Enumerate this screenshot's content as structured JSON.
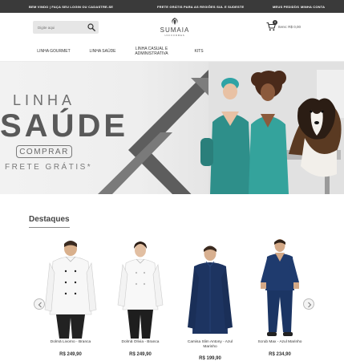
{
  "topbar": {
    "left": "BEM VINDO | FAÇA SEU LOGIN OU CADASTRE-SE",
    "middle": "FRETE GRÁTIS PARA AS REGIÕES SUL E SUDESTE",
    "orders": "MEUS PEDIDOS",
    "separator": "|",
    "account": "MINHA CONTA"
  },
  "search": {
    "placeholder": "Digite aqui"
  },
  "logo": {
    "name": "SUMAIA",
    "sub": "UNIFORMES"
  },
  "cart": {
    "count": "0",
    "text": "Itens: R$ 0,00"
  },
  "nav": [
    {
      "label": "LINHA GOURMET"
    },
    {
      "label": "LINHA SAÚDE"
    },
    {
      "label": "LINHA CASUAL E ADMINISTRATIVA"
    },
    {
      "label": "KITS"
    }
  ],
  "banner": {
    "line1": "LINHA",
    "line2": "SAÚDE",
    "cta": "COMPRAR",
    "shipping": "FRETE GRÁTIS*"
  },
  "section": {
    "title": "Destaques"
  },
  "products": [
    {
      "name": "Dolmã Livorno - Branca",
      "price": "R$ 249,90",
      "icon": "white-chef-jacket-man"
    },
    {
      "name": "Dolmã Olívia - Branca",
      "price": "R$ 249,90",
      "icon": "white-chef-jacket-woman"
    },
    {
      "name": "Camisa Slim Antony - Azul Marinho",
      "price": "R$ 199,90",
      "icon": "navy-shirt-man"
    },
    {
      "name": "Scrub Max - Azul Marinho",
      "price": "R$ 234,90",
      "icon": "navy-scrub-man"
    }
  ],
  "colors": {
    "topbar": "#3a3a3a",
    "navy": "#1d3461",
    "teal": "#2e8f8a"
  }
}
